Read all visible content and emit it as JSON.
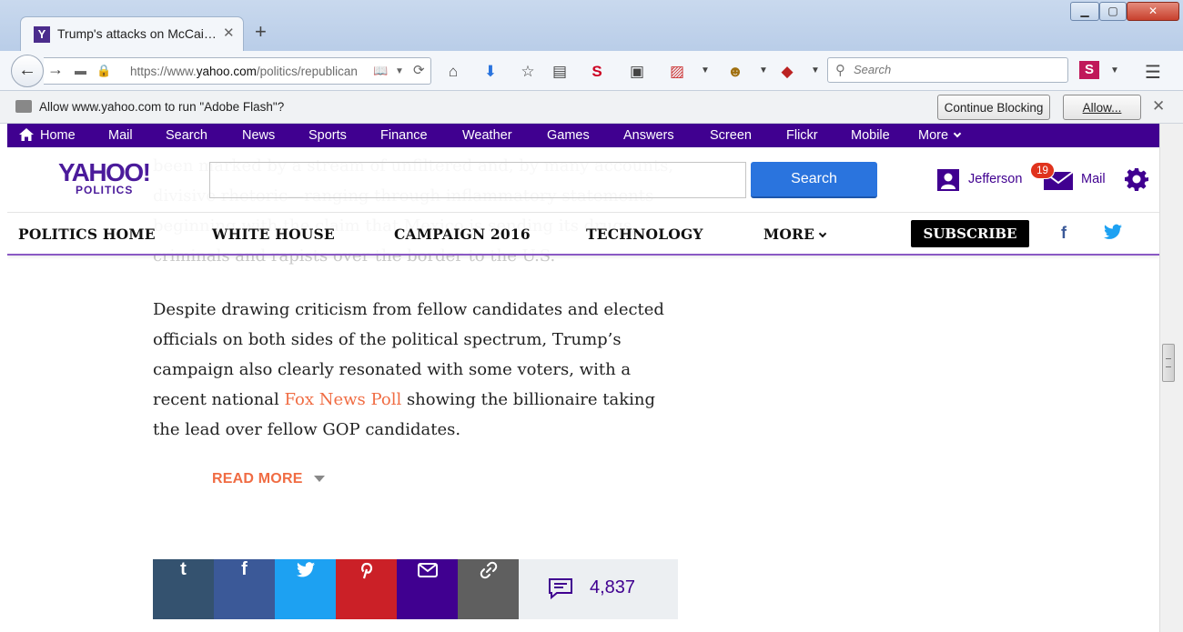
{
  "browser": {
    "tab_title": "Trump's attacks on McCai…",
    "url_host": "https://www.",
    "url_domain": "yahoo.com",
    "url_path": "/politics/republican",
    "search_placeholder": "Search",
    "notification_text": "Allow www.yahoo.com to run \"Adobe Flash\"?",
    "continue_blocking": "Continue Blocking",
    "allow": "Allow..."
  },
  "yahoo_bar": {
    "items": [
      "Home",
      "Mail",
      "Search",
      "News",
      "Sports",
      "Finance",
      "Weather",
      "Games",
      "Answers",
      "Screen",
      "Flickr",
      "Mobile",
      "More"
    ]
  },
  "header": {
    "logo": "YAHOO!",
    "logo_sub": "POLITICS",
    "search_button": "Search",
    "user_name": "Jefferson",
    "mail_count": "19",
    "mail_label": "Mail"
  },
  "subnav": {
    "items": [
      "POLITICS HOME",
      "WHITE HOUSE",
      "CAMPAIGN 2016",
      "TECHNOLOGY",
      "MORE"
    ],
    "subscribe": "SUBSCRIBE"
  },
  "article": {
    "faded_paragraph": "been marked by a stream of unfiltered and, by many accounts, divisive rhetoric—ranging through inflammatory statements beginning with the claim that Mexico is sending its drugs, criminals and rapists over the border to the U.S.",
    "paragraph_before_link": "Despite drawing criticism from fellow candidates and elected officials on both sides of the political spectrum, Trump’s campaign also clearly resonated with some voters, with a recent national ",
    "link_text": "Fox News Poll",
    "paragraph_after_link": " showing the billionaire taking the lead over fellow GOP candidates.",
    "read_more": "READ MORE"
  },
  "share": {
    "comment_count": "4,837",
    "colors": {
      "tumblr": "#34526f",
      "facebook": "#3b5998",
      "twitter": "#1da1f2",
      "pinterest": "#cb2027",
      "email": "#400090",
      "link": "#5f5f5f"
    }
  },
  "colors": {
    "yahoo_purple": "#400090",
    "accent_orange": "#f06c43",
    "search_blue": "#2a74de"
  }
}
